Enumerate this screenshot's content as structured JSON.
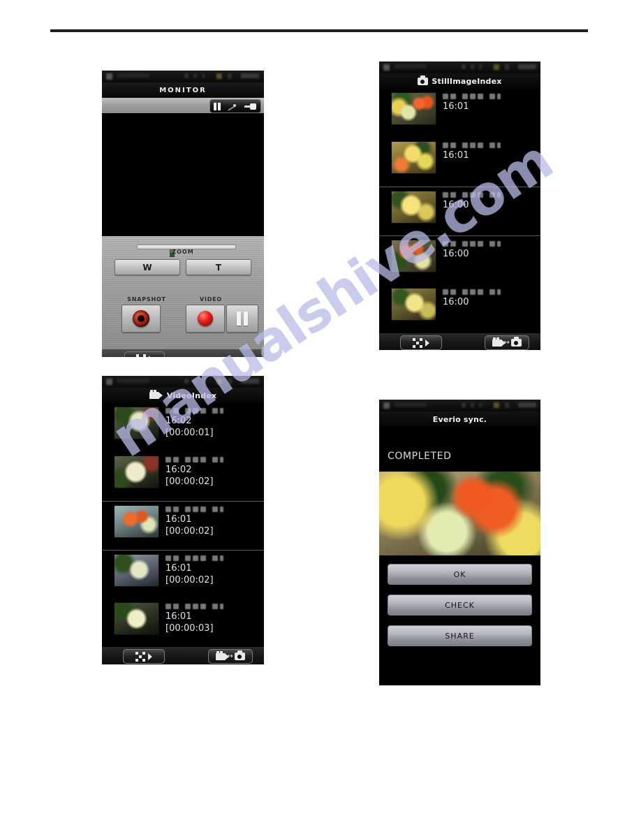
{
  "watermark": {
    "text": "manualshive.com",
    "color": "#b9bbe8"
  },
  "screens": {
    "monitor": {
      "title": "MONITOR",
      "topbar": {
        "pause_icon": "pause-icon",
        "cable_icon": "cable-icon",
        "plug_icon": "plug-icon"
      },
      "zoom_label": "ZOOM",
      "wide_label": "W",
      "tele_label": "T",
      "snapshot_label": "SNAPSHOT",
      "video_label": "VIDEO",
      "snapshot_icon": "shutter-icon",
      "record_icon": "record-dot-icon",
      "pause_icon": "pause-icon",
      "nav_index_icon": "thumbnail-index-icon"
    },
    "still_index": {
      "title": "StillImageIndex",
      "title_icon": "still-camera-icon",
      "nav_index_icon": "thumbnail-index-icon",
      "nav_swap_icon": "video-still-swap-icon",
      "rows": [
        {
          "date": "■■ ■■■ ■",
          "time": "16:01",
          "art": "art-a",
          "separator": false
        },
        {
          "date": "■■ ■■■ ■",
          "time": "16:01",
          "art": "art-b",
          "separator": false
        },
        {
          "date": "■■ ■■■ ■",
          "time": "16:00",
          "art": "art-c",
          "separator": true
        },
        {
          "date": "■■ ■■■ ■",
          "time": "16:00",
          "art": "art-d",
          "separator": true
        },
        {
          "date": "■■ ■■■ ■",
          "time": "16:00",
          "art": "art-e",
          "separator": false
        }
      ]
    },
    "video_index": {
      "title": "VideoIndex",
      "title_icon": "video-camera-icon",
      "nav_index_icon": "thumbnail-index-icon",
      "nav_swap_icon": "video-still-swap-icon",
      "rows": [
        {
          "date": "■■ ■■■ ■",
          "time": "16:02",
          "duration": "[00:00:01]",
          "art": "art-v1",
          "separator": false
        },
        {
          "date": "■■ ■■■ ■",
          "time": "16:02",
          "duration": "[00:00:02]",
          "art": "art-v2",
          "separator": false
        },
        {
          "date": "■■ ■■■ ■",
          "time": "16:01",
          "duration": "[00:00:02]",
          "art": "art-v3",
          "separator": true
        },
        {
          "date": "■■ ■■■ ■",
          "time": "16:01",
          "duration": "[00:00:02]",
          "art": "art-v4",
          "separator": true
        },
        {
          "date": "■■ ■■■ ■",
          "time": "16:01",
          "duration": "[00:00:03]",
          "art": "art-v5",
          "separator": false
        }
      ]
    },
    "everio_sync": {
      "title": "Everio sync.",
      "status": "COMPLETED",
      "buttons": [
        {
          "label": "OK"
        },
        {
          "label": "CHECK"
        },
        {
          "label": "SHARE"
        }
      ]
    }
  }
}
